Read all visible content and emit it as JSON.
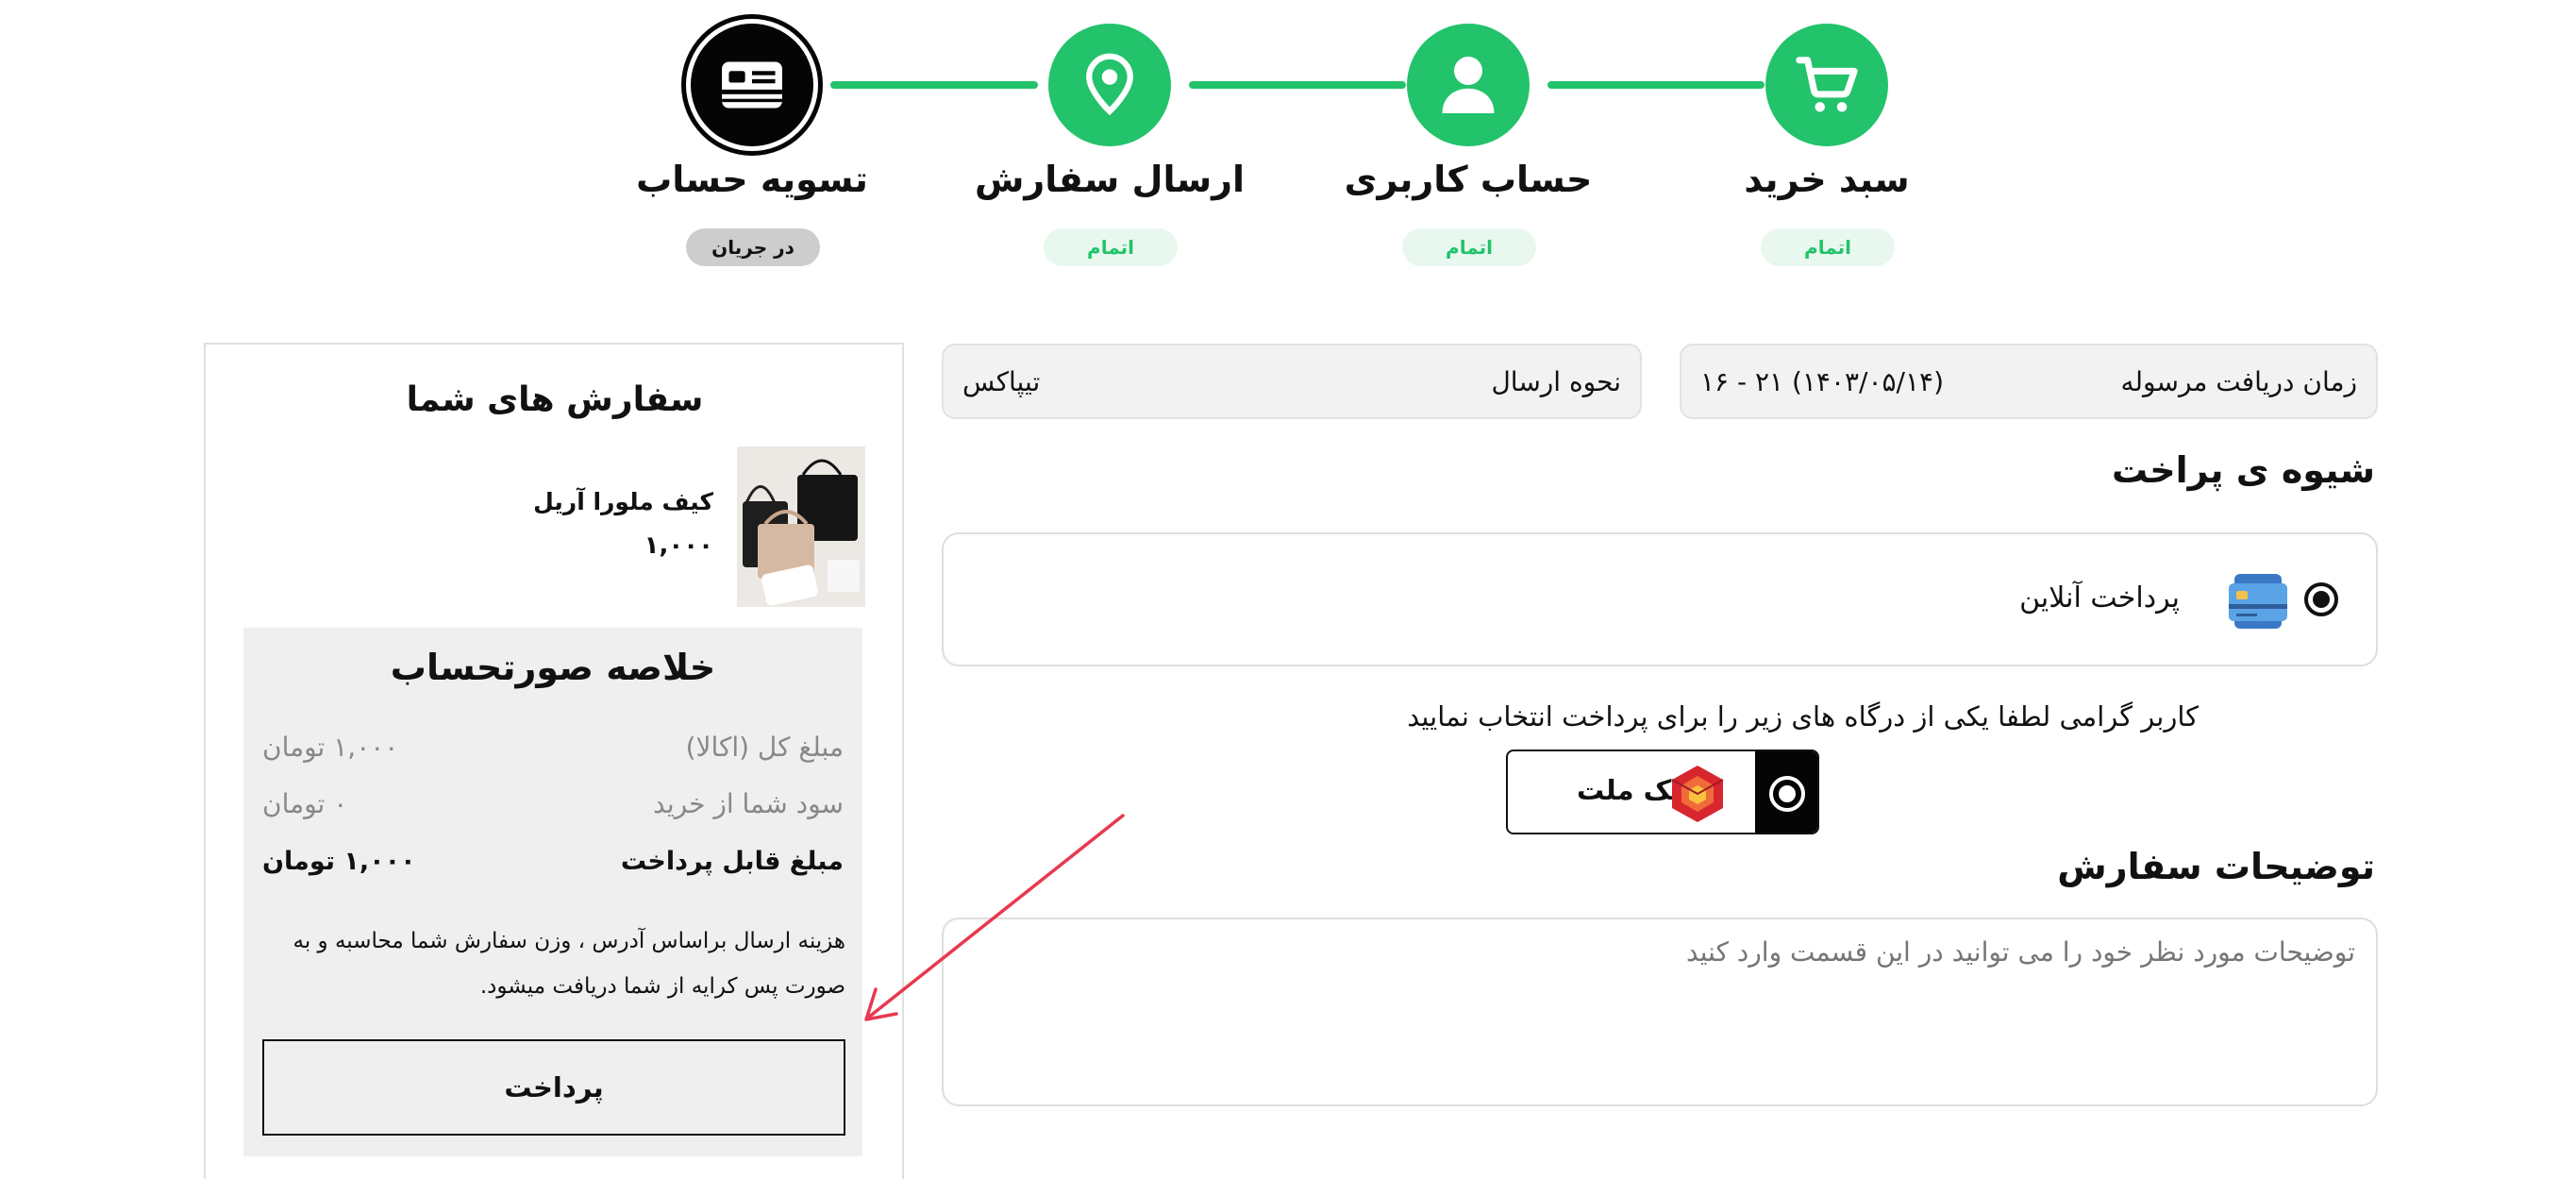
{
  "stepper": {
    "steps": [
      {
        "title": "سبد خرید",
        "status": "اتمام",
        "icon": "cart-icon"
      },
      {
        "title": "حساب کاربری",
        "status": "اتمام",
        "icon": "user-icon"
      },
      {
        "title": "ارسال سفارش",
        "status": "اتمام",
        "icon": "location-pin-icon"
      },
      {
        "title": "تسویه حساب",
        "status": "در جریان",
        "icon": "credit-card-icon"
      }
    ],
    "accent_color": "#22c36b",
    "active_color": "#050505"
  },
  "delivery": {
    "time_label": "زمان دریافت مرسوله",
    "time_value": "(۱۴۰۳/۰۵/۱۴) ۲۱ - ۱۶",
    "method_label": "نحوه ارسال",
    "method_value": "تیپاکس"
  },
  "payment": {
    "section_title": "شیوه ی پراخت",
    "option_label": "پرداخت آنلاین",
    "gateway_message": "کاربر گرامی لطفا یکی از درگاه های زیر را برای پرداخت انتخاب نمایید",
    "gateway_name": "بانک ملت"
  },
  "notes": {
    "section_title": "توضیحات سفارش",
    "placeholder": "توضیحات مورد نظر خود را می توانید در این قسمت وارد کنید"
  },
  "sidebar": {
    "title": "سفارش های شما",
    "product": {
      "name": "کیف ملورا آریل",
      "price": "۱,۰۰۰"
    },
    "summary": {
      "title": "خلاصه صورتحساب",
      "rows": [
        {
          "label": "مبلغ کل (اکالا)",
          "value": "۱,۰۰۰ تومان"
        },
        {
          "label": "سود شما از خرید",
          "value": "۰ تومان"
        },
        {
          "label": "مبلغ قابل پرداخت",
          "value": "۱,۰۰۰ تومان"
        }
      ],
      "note": "هزینه ارسال براساس آدرس ، وزن سفارش شما محاسبه و به صورت پس کرایه از شما دریافت میشود.",
      "pay_button": "پرداخت"
    }
  }
}
